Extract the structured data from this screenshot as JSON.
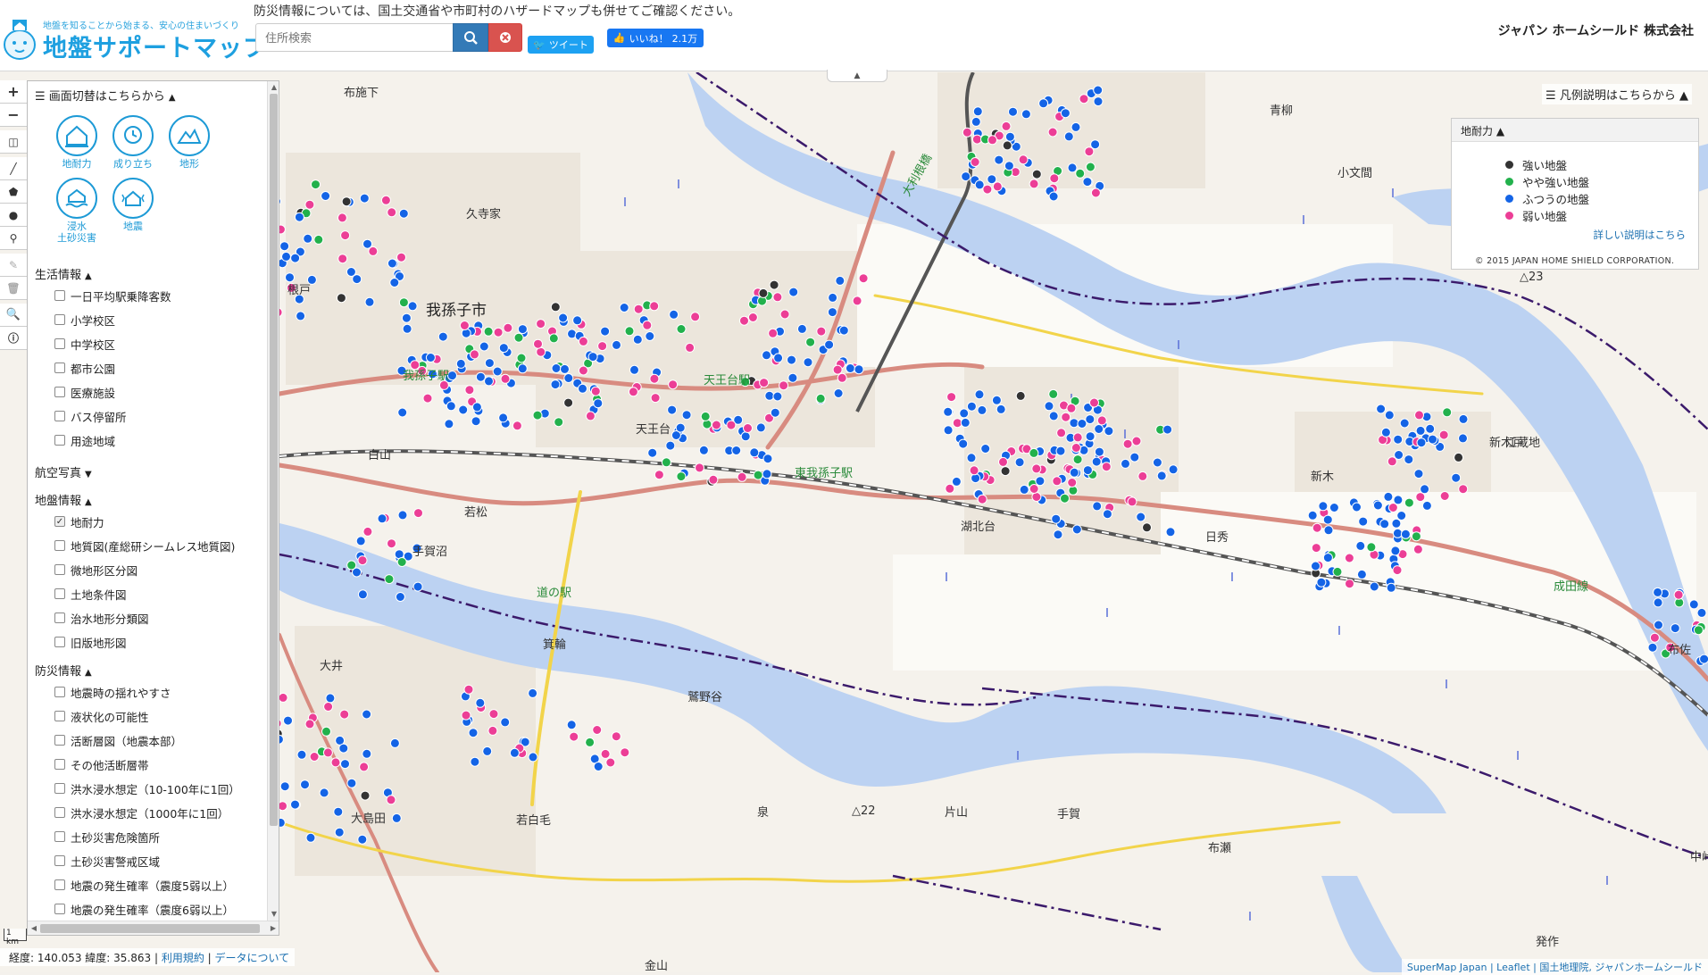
{
  "header": {
    "tagline": "地盤を知ることから始まる、安心の住まいづくり",
    "brand": "地盤サポートマップ",
    "notice": "防災情報については、国土交通省や市町村のハザードマップも併せてご確認ください。",
    "search_placeholder": "住所検索",
    "tweet_label": "ツイート",
    "like_label": "いいね！",
    "like_count": "2.1万",
    "company": "ジャパン ホームシールド 株式会社"
  },
  "toolbar": {
    "zoom_in": "+",
    "zoom_out": "−"
  },
  "panel": {
    "switch_header": "画面切替はこちらから",
    "layers": [
      {
        "label": "地耐力"
      },
      {
        "label": "成り立ち"
      },
      {
        "label": "地形"
      },
      {
        "label": "浸水\n土砂災害"
      },
      {
        "label": "地震"
      }
    ],
    "sections": {
      "life": {
        "title": "生活情報",
        "items": [
          "一日平均駅乗降客数",
          "小学校区",
          "中学校区",
          "都市公園",
          "医療施設",
          "バス停留所",
          "用途地域"
        ]
      },
      "aerial": {
        "title": "航空写真"
      },
      "ground": {
        "title": "地盤情報",
        "items": [
          "地耐力",
          "地質図(産総研シームレス地質図)",
          "微地形区分図",
          "土地条件図",
          "治水地形分類図",
          "旧版地形図"
        ],
        "checked_index": 0
      },
      "disaster": {
        "title": "防災情報",
        "items": [
          "地震時の揺れやすさ",
          "液状化の可能性",
          "活断層図（地震本部）",
          "その他活断層帯",
          "洪水浸水想定（10-100年に1回）",
          "洪水浸水想定（1000年に1回）",
          "土砂災害危険箇所",
          "土砂災害警戒区域",
          "地震の発生確率（震度5弱以上）",
          "地震の発生確率（震度6弱以上）"
        ]
      }
    }
  },
  "legend": {
    "toggle": "凡例説明はこちらから",
    "title": "地耐力",
    "items": [
      {
        "label": "強い地盤",
        "color": "#333333"
      },
      {
        "label": "やや強い地盤",
        "color": "#22b14c"
      },
      {
        "label": "ふつうの地盤",
        "color": "#1464e6"
      },
      {
        "label": "弱い地盤",
        "color": "#ec3e96"
      }
    ],
    "more": "詳しい説明はこちら",
    "copyright": "© 2015 JAPAN HOME SHIELD CORPORATION."
  },
  "status": {
    "coords": "経度: 140.053 緯度: 35.863",
    "terms": "利用規約",
    "data": "データについて",
    "scale": "1 km",
    "attribution": "SuperMap Japan | Leaflet | 国土地理院, ジャパンホームシールド"
  },
  "map": {
    "places": [
      {
        "name": "布施下",
        "cls": ""
      },
      {
        "name": "久寺家",
        "cls": ""
      },
      {
        "name": "我孫子市",
        "cls": "big"
      },
      {
        "name": "我孫子駅",
        "cls": "green"
      },
      {
        "name": "天王台駅",
        "cls": "green"
      },
      {
        "name": "東我孫子駅",
        "cls": "green"
      },
      {
        "name": "天王台",
        "cls": ""
      },
      {
        "name": "若松",
        "cls": ""
      },
      {
        "name": "白山",
        "cls": ""
      },
      {
        "name": "手賀沼",
        "cls": ""
      },
      {
        "name": "道の駅",
        "cls": "green"
      },
      {
        "name": "箕輪",
        "cls": ""
      },
      {
        "name": "鷲野谷",
        "cls": ""
      },
      {
        "name": "大井",
        "cls": ""
      },
      {
        "name": "大島田",
        "cls": ""
      },
      {
        "name": "若白毛",
        "cls": ""
      },
      {
        "name": "片山",
        "cls": ""
      },
      {
        "name": "手賀",
        "cls": ""
      },
      {
        "name": "布瀬",
        "cls": ""
      },
      {
        "name": "泉",
        "cls": ""
      },
      {
        "name": "湖北台",
        "cls": ""
      },
      {
        "name": "日秀",
        "cls": ""
      },
      {
        "name": "新木",
        "cls": ""
      },
      {
        "name": "江蔵地",
        "cls": ""
      },
      {
        "name": "成田線",
        "cls": "green"
      },
      {
        "name": "布佐",
        "cls": ""
      },
      {
        "name": "青柳",
        "cls": ""
      },
      {
        "name": "小文間",
        "cls": ""
      },
      {
        "name": "大利根橋",
        "cls": "green"
      },
      {
        "name": "根戸",
        "cls": ""
      },
      {
        "name": "発作",
        "cls": ""
      },
      {
        "name": "金山",
        "cls": ""
      },
      {
        "name": "中峠",
        "cls": ""
      },
      {
        "name": "新木戸",
        "cls": ""
      },
      {
        "name": "△23",
        "cls": ""
      },
      {
        "name": "△22",
        "cls": ""
      }
    ]
  }
}
